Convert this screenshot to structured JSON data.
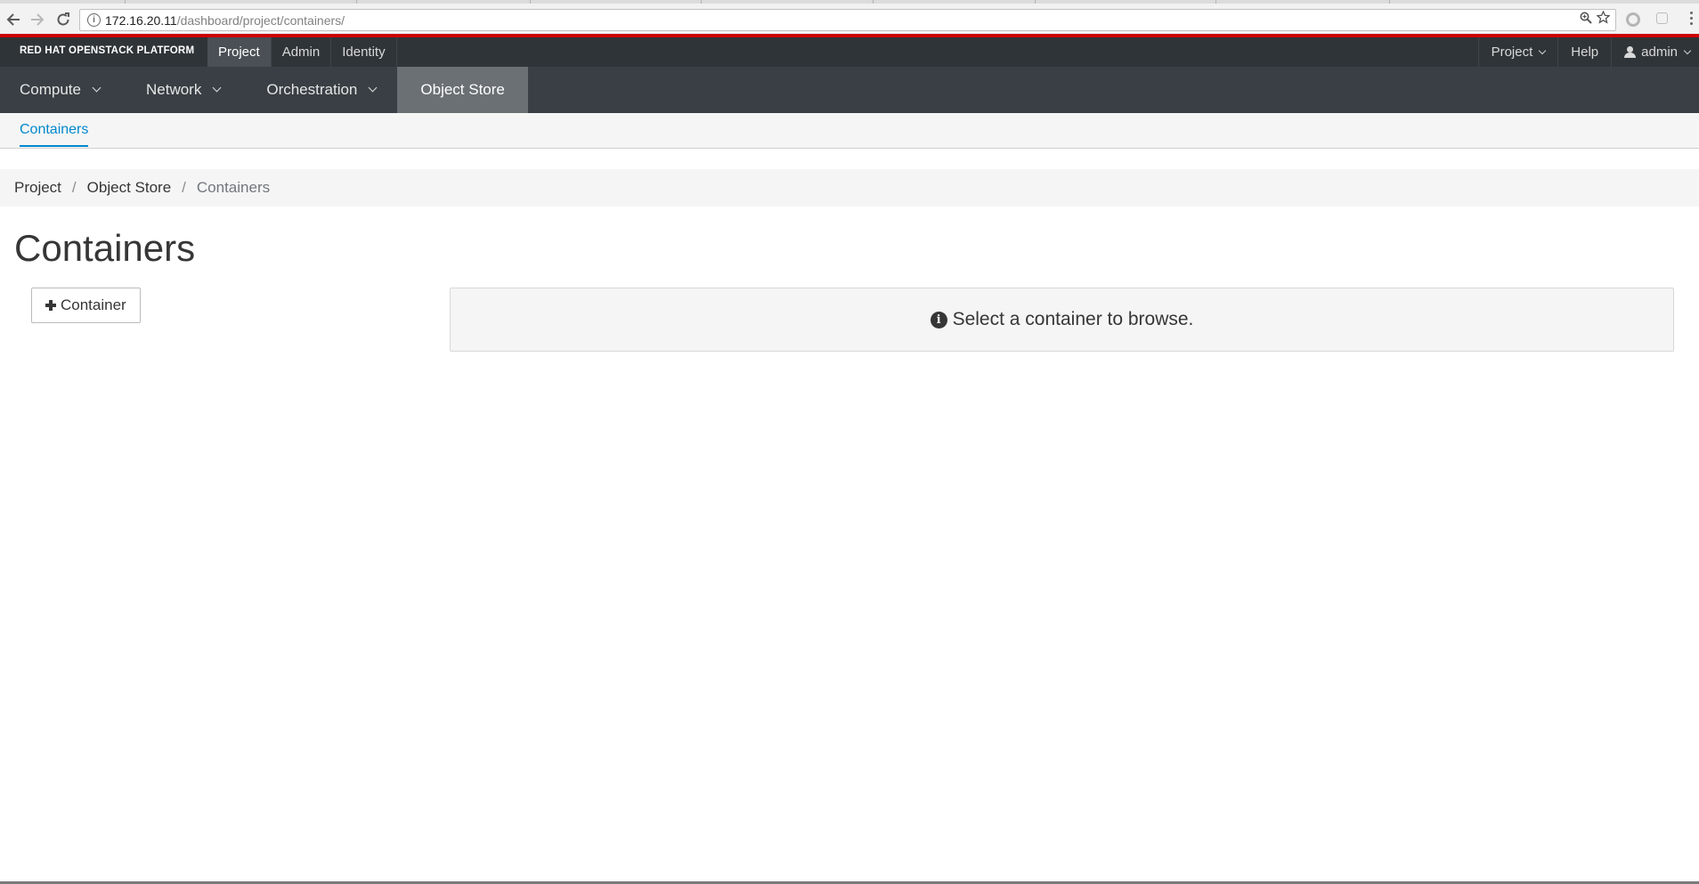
{
  "browser": {
    "url_host": "172.16.20.11",
    "url_path": "/dashboard/project/containers/",
    "back_glyph": "back-arrow-icon",
    "forward_glyph": "forward-arrow-icon"
  },
  "masthead": {
    "brand": "RED HAT OPENSTACK PLATFORM",
    "left_items": [
      {
        "label": "Project",
        "active": true
      },
      {
        "label": "Admin",
        "active": false
      },
      {
        "label": "Identity",
        "active": false
      }
    ],
    "project_menu": "Project",
    "help": "Help",
    "user": "admin"
  },
  "secondary_nav": {
    "items": [
      {
        "label": "Compute"
      },
      {
        "label": "Network"
      },
      {
        "label": "Orchestration"
      },
      {
        "label": "Object Store"
      }
    ]
  },
  "tertiary_nav": {
    "active_tab": "Containers"
  },
  "breadcrumb": {
    "items": [
      "Project",
      "Object Store",
      "Containers"
    ],
    "separator": "/"
  },
  "page": {
    "title": "Containers",
    "add_button_label": "Container",
    "info_message": "Select a container to browse.",
    "info_glyph": "i"
  },
  "colors": {
    "accent_red": "#cc0000",
    "masthead_bg": "#2f3438",
    "link_blue": "#0088ce"
  }
}
